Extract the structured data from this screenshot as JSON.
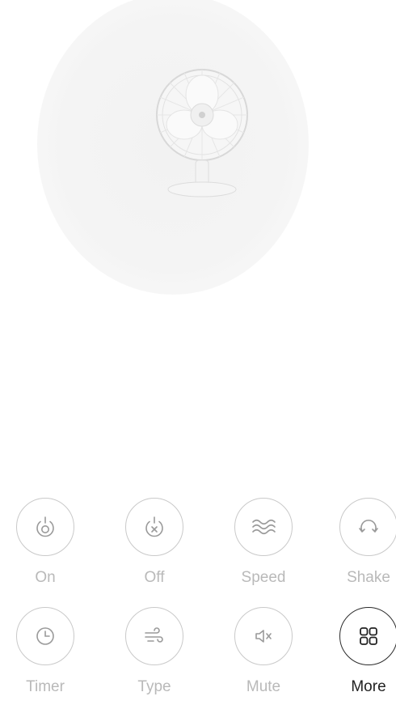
{
  "device": {
    "image_icon": "desk-fan"
  },
  "controls": [
    {
      "id": "on",
      "label": "On",
      "icon": "power-on-icon",
      "active": false
    },
    {
      "id": "off",
      "label": "Off",
      "icon": "power-off-icon",
      "active": false
    },
    {
      "id": "speed",
      "label": "Speed",
      "icon": "wind-waves-icon",
      "active": false
    },
    {
      "id": "shake",
      "label": "Shake",
      "icon": "oscillate-icon",
      "active": false
    },
    {
      "id": "timer",
      "label": "Timer",
      "icon": "clock-icon",
      "active": false
    },
    {
      "id": "type",
      "label": "Type",
      "icon": "wind-type-icon",
      "active": false
    },
    {
      "id": "mute",
      "label": "Mute",
      "icon": "speaker-mute-icon",
      "active": false
    },
    {
      "id": "more",
      "label": "More",
      "icon": "grid-icon",
      "active": true
    }
  ],
  "colors": {
    "inactive": "#b9b9b9",
    "active": "#222222",
    "halo": "#f3f3f3"
  }
}
